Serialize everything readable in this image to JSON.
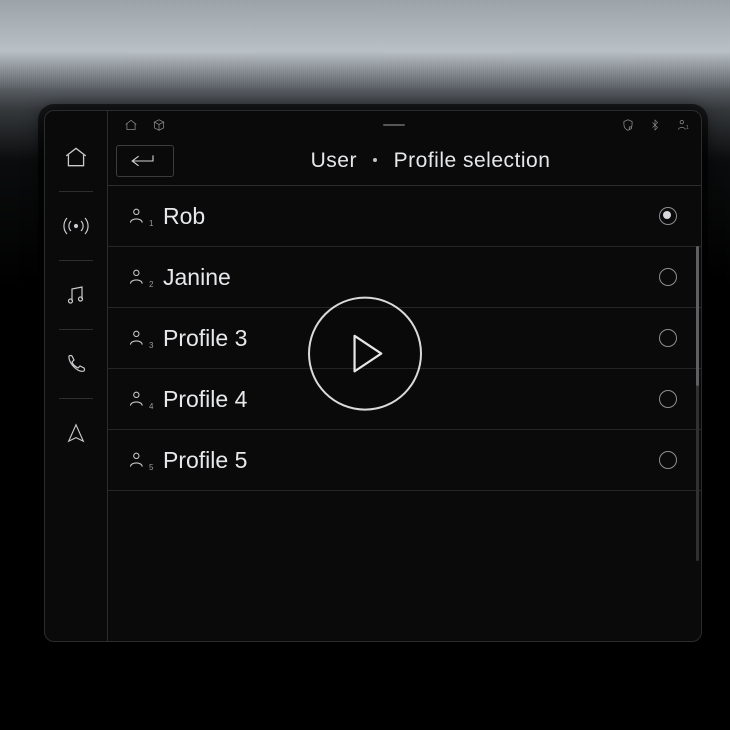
{
  "breadcrumb": {
    "a": "User",
    "b": "Profile selection"
  },
  "sidenav": {
    "home": {
      "name": "home-icon"
    },
    "radio": {
      "name": "antenna-icon"
    },
    "media": {
      "name": "music-icon"
    },
    "phone": {
      "name": "phone-icon"
    },
    "nav": {
      "name": "navigation-arrow-icon"
    }
  },
  "status": {
    "left": [
      "home-small-icon",
      "cube-icon"
    ],
    "right": [
      "shield-icon",
      "bluetooth-icon",
      "user-small-icon"
    ]
  },
  "profiles": [
    {
      "idx": "1",
      "name": "Rob",
      "selected": true
    },
    {
      "idx": "2",
      "name": "Janine",
      "selected": false
    },
    {
      "idx": "3",
      "name": "Profile 3",
      "selected": false
    },
    {
      "idx": "4",
      "name": "Profile 4",
      "selected": false
    },
    {
      "idx": "5",
      "name": "Profile 5",
      "selected": false
    }
  ],
  "overlay": {
    "play_label": "Play video"
  }
}
